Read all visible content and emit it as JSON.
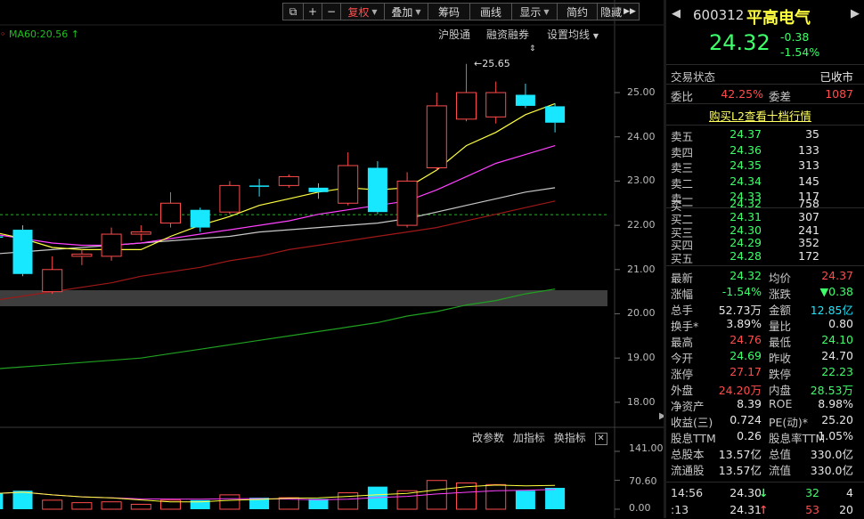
{
  "toolbar": {
    "buttons": [
      {
        "label": "复权",
        "active": true,
        "dropdown": true
      },
      {
        "label": "叠加",
        "dropdown": true
      },
      {
        "label": "筹码"
      },
      {
        "label": "画线"
      },
      {
        "label": "显示",
        "dropdown": true
      },
      {
        "label": "简约"
      },
      {
        "label": "隐藏"
      }
    ]
  },
  "subbar": {
    "hgt": "沪股通",
    "margin": "融资融券",
    "ma_settings": "设置均线"
  },
  "ma_legend": {
    "ma60_label": "MA60:20.56",
    "arrow": "↑"
  },
  "price_axis": [
    "25.00",
    "24.00",
    "23.00",
    "22.00",
    "21.00",
    "20.00",
    "19.00",
    "18.00"
  ],
  "volume_axis": [
    "141.00",
    "70.60",
    "0.00"
  ],
  "max_annotation": "25.65",
  "volume_tools": {
    "params": "改参数",
    "add": "加指标",
    "switch": "换指标",
    "close": "✕"
  },
  "stock": {
    "code": "600312",
    "name": "平高电气",
    "price": "24.32",
    "change": "-0.38",
    "change_pct": "-1.54%"
  },
  "trade_status": {
    "label": "交易状态",
    "value": "已收市"
  },
  "commission": {
    "ratio_label": "委比",
    "ratio_value": "42.25%",
    "diff_label": "委差",
    "diff_value": "1087"
  },
  "l2_link": "购买L2查看十档行情",
  "order_book": {
    "asks": [
      {
        "label": "卖五",
        "price": "24.37",
        "vol": "35"
      },
      {
        "label": "卖四",
        "price": "24.36",
        "vol": "133"
      },
      {
        "label": "卖三",
        "price": "24.35",
        "vol": "313"
      },
      {
        "label": "卖二",
        "price": "24.34",
        "vol": "145"
      },
      {
        "label": "卖一",
        "price": "24.33",
        "vol": "117"
      }
    ],
    "bids": [
      {
        "label": "买一",
        "price": "24.32",
        "vol": "758"
      },
      {
        "label": "买二",
        "price": "24.31",
        "vol": "307"
      },
      {
        "label": "买三",
        "price": "24.30",
        "vol": "241"
      },
      {
        "label": "买四",
        "price": "24.29",
        "vol": "352"
      },
      {
        "label": "买五",
        "price": "24.28",
        "vol": "172"
      }
    ]
  },
  "stats": [
    {
      "l1": "最新",
      "v1": "24.32",
      "c1": "green",
      "l2": "均价",
      "v2": "24.37",
      "c2": "red"
    },
    {
      "l1": "涨幅",
      "v1": "-1.54%",
      "c1": "green",
      "l2": "涨跌",
      "v2": "▼0.38",
      "c2": "green"
    },
    {
      "l1": "总手",
      "v1": "52.73万",
      "c1": "white",
      "l2": "金额",
      "v2": "12.85亿",
      "c2": "cyan"
    },
    {
      "l1": "换手*",
      "v1": "3.89%",
      "c1": "white",
      "l2": "量比",
      "v2": "0.80",
      "c2": "white"
    },
    {
      "l1": "最高",
      "v1": "24.76",
      "c1": "red",
      "l2": "最低",
      "v2": "24.10",
      "c2": "green"
    },
    {
      "l1": "今开",
      "v1": "24.69",
      "c1": "green",
      "l2": "昨收",
      "v2": "24.70",
      "c2": "white"
    },
    {
      "l1": "涨停",
      "v1": "27.17",
      "c1": "red",
      "l2": "跌停",
      "v2": "22.23",
      "c2": "green"
    },
    {
      "l1": "外盘",
      "v1": "24.20万",
      "c1": "red",
      "l2": "内盘",
      "v2": "28.53万",
      "c2": "green"
    },
    {
      "l1": "净资产",
      "v1": "8.39",
      "c1": "white",
      "l2": "ROE",
      "v2": "8.98%",
      "c2": "white"
    },
    {
      "l1": "收益(三)",
      "v1": "0.724",
      "c1": "white",
      "l2": "PE(动)*",
      "v2": "25.20",
      "c2": "white"
    },
    {
      "l1": "股息TTM",
      "v1": "0.26",
      "c1": "white",
      "l2": "股息率TTM",
      "v2": "1.05%",
      "c2": "white"
    },
    {
      "l1": "总股本",
      "v1": "13.57亿",
      "c1": "white",
      "l2": "总值",
      "v2": "330.0亿",
      "c2": "white"
    },
    {
      "l1": "流通股",
      "v1": "13.57亿",
      "c1": "white",
      "l2": "流值",
      "v2": "330.0亿",
      "c2": "white"
    }
  ],
  "ticks": [
    {
      "time": "14:56",
      "price": "24.30",
      "dir": "↓",
      "vol": "32",
      "n": "4",
      "pc": "white",
      "vc": "green"
    },
    {
      "time": ":13",
      "price": "24.31",
      "dir": "↑",
      "vol": "53",
      "n": "20",
      "pc": "white",
      "vc": "red"
    }
  ],
  "colors": {
    "up": "#ff4c4c",
    "down": "#18e8ff",
    "ma5": "#ffff40",
    "ma10": "#ff40ff",
    "ma20": "#c8c8c8",
    "ma30": "#a01818",
    "ma60": "#20a020"
  },
  "chart_data": {
    "type": "candlestick",
    "price_range": [
      17.5,
      26.2
    ],
    "volume_range": [
      0,
      141
    ],
    "reference_price": 22.23,
    "candles": [
      {
        "o": 21.75,
        "c": 21.75,
        "h": 22.05,
        "l": 21.6,
        "dir": "down",
        "v": 38
      },
      {
        "o": 21.9,
        "c": 20.9,
        "h": 22.0,
        "l": 20.85,
        "dir": "down",
        "v": 45
      },
      {
        "o": 20.5,
        "c": 21.0,
        "h": 21.3,
        "l": 20.45,
        "dir": "up",
        "v": 22
      },
      {
        "o": 21.3,
        "c": 21.35,
        "h": 21.45,
        "l": 21.1,
        "dir": "up",
        "v": 16
      },
      {
        "o": 21.3,
        "c": 21.8,
        "h": 21.95,
        "l": 21.2,
        "dir": "up",
        "v": 18
      },
      {
        "o": 21.8,
        "c": 21.85,
        "h": 22.0,
        "l": 21.65,
        "dir": "up",
        "v": 12
      },
      {
        "o": 22.05,
        "c": 22.5,
        "h": 22.75,
        "l": 21.95,
        "dir": "up",
        "v": 22
      },
      {
        "o": 22.35,
        "c": 21.95,
        "h": 22.4,
        "l": 21.85,
        "dir": "down",
        "v": 22
      },
      {
        "o": 22.3,
        "c": 22.9,
        "h": 23.0,
        "l": 22.25,
        "dir": "up",
        "v": 35
      },
      {
        "o": 22.9,
        "c": 22.9,
        "h": 23.05,
        "l": 22.65,
        "dir": "down",
        "v": 28
      },
      {
        "o": 22.9,
        "c": 23.1,
        "h": 23.15,
        "l": 22.85,
        "dir": "up",
        "v": 28
      },
      {
        "o": 22.85,
        "c": 22.75,
        "h": 22.95,
        "l": 22.6,
        "dir": "down",
        "v": 25
      },
      {
        "o": 22.5,
        "c": 23.35,
        "h": 23.65,
        "l": 22.45,
        "dir": "up",
        "v": 40
      },
      {
        "o": 23.3,
        "c": 22.3,
        "h": 23.45,
        "l": 22.25,
        "dir": "down",
        "v": 55
      },
      {
        "o": 22.0,
        "c": 23.0,
        "h": 23.2,
        "l": 21.95,
        "dir": "up",
        "v": 45
      },
      {
        "o": 23.3,
        "c": 24.7,
        "h": 25.0,
        "l": 23.25,
        "dir": "up",
        "v": 70
      },
      {
        "o": 24.4,
        "c": 25.0,
        "h": 25.65,
        "l": 24.35,
        "dir": "up",
        "v": 64
      },
      {
        "o": 24.45,
        "c": 25.0,
        "h": 25.25,
        "l": 24.3,
        "dir": "up",
        "v": 60
      },
      {
        "o": 24.95,
        "c": 24.7,
        "h": 25.2,
        "l": 24.65,
        "dir": "down",
        "v": 45
      },
      {
        "o": 24.69,
        "c": 24.32,
        "h": 24.76,
        "l": 24.1,
        "dir": "down",
        "v": 52
      }
    ],
    "ma5": [
      21.85,
      21.7,
      21.5,
      21.45,
      21.45,
      21.45,
      21.75,
      22.0,
      22.2,
      22.45,
      22.6,
      22.75,
      22.85,
      22.8,
      22.85,
      23.25,
      23.8,
      24.1,
      24.5,
      24.75
    ],
    "ma10": [
      21.8,
      21.7,
      21.6,
      21.55,
      21.55,
      21.6,
      21.7,
      21.8,
      21.9,
      22.0,
      22.1,
      22.25,
      22.35,
      22.45,
      22.55,
      22.8,
      23.1,
      23.4,
      23.6,
      23.8
    ],
    "ma20": [
      21.35,
      21.4,
      21.45,
      21.5,
      21.55,
      21.6,
      21.65,
      21.7,
      21.75,
      21.85,
      21.9,
      21.95,
      22.0,
      22.05,
      22.15,
      22.3,
      22.45,
      22.6,
      22.75,
      22.85
    ],
    "ma30": [
      20.3,
      20.4,
      20.5,
      20.6,
      20.7,
      20.85,
      20.95,
      21.05,
      21.2,
      21.3,
      21.45,
      21.55,
      21.65,
      21.75,
      21.85,
      21.95,
      22.1,
      22.25,
      22.4,
      22.55
    ],
    "ma60": [
      18.75,
      18.8,
      18.85,
      18.9,
      18.95,
      19.0,
      19.1,
      19.2,
      19.3,
      19.4,
      19.5,
      19.6,
      19.7,
      19.8,
      19.95,
      20.05,
      20.2,
      20.3,
      20.45,
      20.56
    ]
  }
}
